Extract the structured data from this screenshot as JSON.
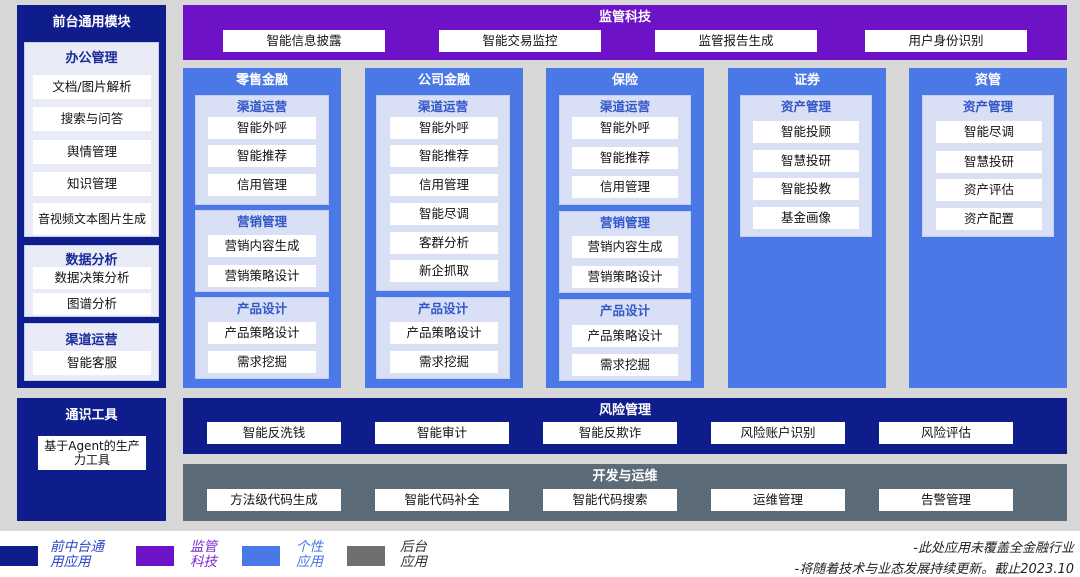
{
  "front": {
    "title": "前台通用模块",
    "office": {
      "title": "办公管理",
      "items": [
        "文档/图片解析",
        "搜索与问答",
        "舆情管理",
        "知识管理",
        "音视频文本图片生成"
      ]
    },
    "data": {
      "title": "数据分析",
      "items": [
        "数据决策分析",
        "图谱分析"
      ]
    },
    "channel": {
      "title": "渠道运营",
      "items": [
        "智能客服"
      ]
    }
  },
  "tools": {
    "title": "通识工具",
    "item": "基于Agent的生产力工具"
  },
  "regtech": {
    "title": "监管科技",
    "items": [
      "智能信息披露",
      "智能交易监控",
      "监管报告生成",
      "用户身份识别"
    ]
  },
  "retail": {
    "title": "零售金融",
    "groups": [
      {
        "title": "渠道运营",
        "items": [
          "智能外呼",
          "智能推荐",
          "信用管理"
        ]
      },
      {
        "title": "营销管理",
        "items": [
          "营销内容生成",
          "营销策略设计"
        ]
      },
      {
        "title": "产品设计",
        "items": [
          "产品策略设计",
          "需求挖掘"
        ]
      }
    ]
  },
  "corporate": {
    "title": "公司金融",
    "groups": [
      {
        "title": "渠道运营",
        "items": [
          "智能外呼",
          "智能推荐",
          "信用管理",
          "智能尽调",
          "客群分析",
          "新企抓取"
        ]
      },
      {
        "title": "产品设计",
        "items": [
          "产品策略设计",
          "需求挖掘"
        ]
      }
    ]
  },
  "insurance": {
    "title": "保险",
    "groups": [
      {
        "title": "渠道运营",
        "items": [
          "智能外呼",
          "智能推荐",
          "信用管理"
        ]
      },
      {
        "title": "营销管理",
        "items": [
          "营销内容生成",
          "营销策略设计"
        ]
      },
      {
        "title": "产品设计",
        "items": [
          "产品策略设计",
          "需求挖掘"
        ]
      }
    ]
  },
  "securities": {
    "title": "证券",
    "groups": [
      {
        "title": "资产管理",
        "items": [
          "智能投顾",
          "智慧投研",
          "智能投教",
          "基金画像"
        ]
      }
    ]
  },
  "assetmgmt": {
    "title": "资管",
    "groups": [
      {
        "title": "资产管理",
        "items": [
          "智能尽调",
          "智慧投研",
          "资产评估",
          "资产配置"
        ]
      }
    ]
  },
  "risk": {
    "title": "风险管理",
    "items": [
      "智能反洗钱",
      "智能审计",
      "智能反欺诈",
      "风险账户识别",
      "风险评估"
    ]
  },
  "devops": {
    "title": "开发与运维",
    "items": [
      "方法级代码生成",
      "智能代码补全",
      "智能代码搜索",
      "运维管理",
      "告警管理"
    ]
  },
  "legend": [
    {
      "label_line1": "前中台通",
      "label_line2": "用应用",
      "color": "#0f1d8c"
    },
    {
      "label_line1": "监管",
      "label_line2": "科技",
      "color": "#6e12c8"
    },
    {
      "label_line1": "个性",
      "label_line2": "应用",
      "color": "#4a78e6"
    },
    {
      "label_line1": "后台",
      "label_line2": "应用",
      "color": "#6f6f6f"
    }
  ],
  "footnote": {
    "line1": "-此处应用未覆盖全金融行业",
    "line2": "-将随着技术与业态发展持续更新。截止2023.10"
  },
  "colors": {
    "navy": "#0f1d8c",
    "purple": "#6e12c8",
    "blue": "#4a78e6",
    "slate": "#5c6b78",
    "sub_bg": "#d9e0f5",
    "sub_title": "#3357c8"
  }
}
